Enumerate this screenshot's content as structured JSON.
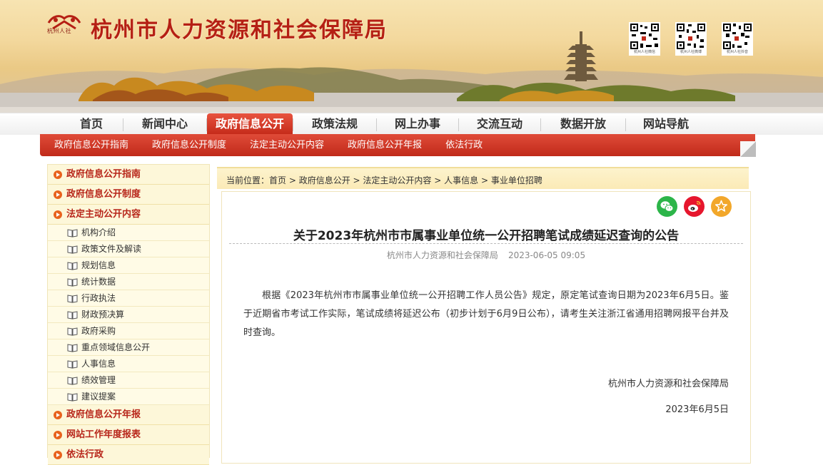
{
  "header": {
    "logo_text": "杭州人社",
    "site_title": "杭州市人力资源和社会保障局",
    "qr_codes": [
      {
        "caption": "杭州人社微信"
      },
      {
        "caption": "杭州人社微博"
      },
      {
        "caption": "杭州人社抖音"
      }
    ]
  },
  "nav": {
    "items": [
      {
        "label": "首页"
      },
      {
        "label": "新闻中心"
      },
      {
        "label": "政府信息公开",
        "active": true
      },
      {
        "label": "政策法规"
      },
      {
        "label": "网上办事"
      },
      {
        "label": "交流互动"
      },
      {
        "label": "数据开放"
      },
      {
        "label": "网站导航"
      }
    ]
  },
  "subnav": {
    "items": [
      {
        "label": "政府信息公开指南"
      },
      {
        "label": "政府信息公开制度"
      },
      {
        "label": "法定主动公开内容"
      },
      {
        "label": "政府信息公开年报"
      },
      {
        "label": "依法行政"
      }
    ]
  },
  "sidebar": {
    "cat_1": "政府信息公开指南",
    "cat_2": "政府信息公开制度",
    "cat_3": "法定主动公开内容",
    "subs": [
      "机构介绍",
      "政策文件及解读",
      "规划信息",
      "统计数据",
      "行政执法",
      "财政预决算",
      "政府采购",
      "重点领域信息公开",
      "人事信息",
      "绩效管理",
      "建议提案"
    ],
    "cat_4": "政府信息公开年报",
    "cat_5": "网站工作年度报表",
    "cat_6": "依法行政"
  },
  "breadcrumb": {
    "prefix": "当前位置：",
    "items": [
      "首页",
      "政府信息公开",
      "法定主动公开内容",
      "人事信息",
      "事业单位招聘"
    ],
    "sep": " > "
  },
  "share": {
    "icons": [
      "wechat-icon",
      "weibo-icon",
      "favorite-icon"
    ],
    "colors": {
      "wechat": "#2cb549",
      "weibo": "#e6162d",
      "favorite": "#f2a72a"
    }
  },
  "article": {
    "title": "关于2023年杭州市市属事业单位统一公开招聘笔试成绩延迟查询的公告",
    "source": "杭州市人力资源和社会保障局",
    "date": "2023-06-05 09:05",
    "body": "根据《2023年杭州市市属事业单位统一公开招聘工作人员公告》规定，原定笔试查询日期为2023年6月5日。鉴于近期省市考试工作实际，笔试成绩将延迟公布（初步计划于6月9日公布），请考生关注浙江省通用招聘网报平台并及时查询。",
    "signature": "杭州市人力资源和社会保障局",
    "sign_date": "2023年6月5日"
  },
  "colors": {
    "brand_red": "#c42a19",
    "title_red": "#b51f14",
    "sidebar_bg": "#fcf6dd"
  }
}
